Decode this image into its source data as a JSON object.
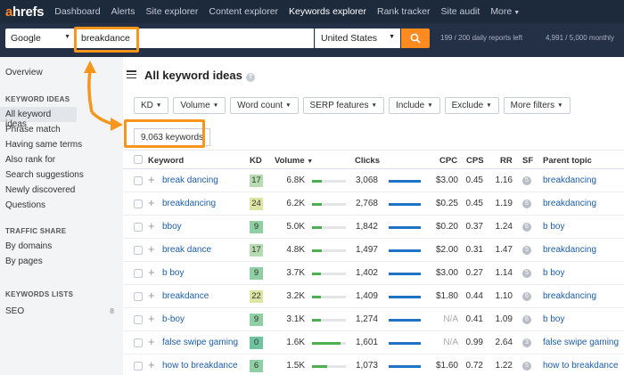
{
  "nav": {
    "logo_a": "a",
    "logo_rest": "hrefs",
    "items": [
      "Dashboard",
      "Alerts",
      "Site explorer",
      "Content explorer",
      "Keywords explorer",
      "Rank tracker",
      "Site audit",
      "More"
    ]
  },
  "search": {
    "engine": "Google",
    "query": "breakdance",
    "country": "United States",
    "limits": "199 / 200 daily reports left",
    "credits": "4,991 / 5,000 monthly"
  },
  "sidebar": {
    "overview": "Overview",
    "keyword_ideas_title": "KEYWORD IDEAS",
    "keyword_ideas": [
      "All keyword ideas",
      "Phrase match",
      "Having same terms",
      "Also rank for",
      "Search suggestions",
      "Newly discovered",
      "Questions"
    ],
    "traffic_share_title": "TRAFFIC SHARE",
    "traffic_share": [
      "By domains",
      "By pages"
    ],
    "keywords_lists_title": "KEYWORDS LISTS",
    "lists": [
      {
        "label": "SEO",
        "count": "8"
      }
    ]
  },
  "main": {
    "title": "All keyword ideas",
    "help": "?",
    "filters": [
      "KD",
      "Volume",
      "Word count",
      "SERP features",
      "Include",
      "Exclude",
      "More filters"
    ],
    "keyword_count": "9,063 keywords"
  },
  "table": {
    "headers": {
      "keyword": "Keyword",
      "kd": "KD",
      "volume": "Volume",
      "clicks": "Clicks",
      "cpc": "CPC",
      "cps": "CPS",
      "rr": "RR",
      "sf": "SF",
      "parent": "Parent topic"
    },
    "rows": [
      {
        "keyword": "break dancing",
        "kd": "17",
        "kd_color": "#b7dcb1",
        "volume": "6.8K",
        "vol_level": 0.3,
        "clicks": "3,068",
        "cpc": "$3.00",
        "cps": "0.45",
        "rr": "1.16",
        "sf": "5",
        "parent": "breakdancing"
      },
      {
        "keyword": "breakdancing",
        "kd": "24",
        "kd_color": "#dde6a0",
        "volume": "6.2K",
        "vol_level": 0.3,
        "clicks": "2,768",
        "cpc": "$0.25",
        "cps": "0.45",
        "rr": "1.19",
        "sf": "6",
        "parent": "breakdancing"
      },
      {
        "keyword": "bboy",
        "kd": "9",
        "kd_color": "#8fcfa3",
        "volume": "5.0K",
        "vol_level": 0.28,
        "clicks": "1,842",
        "cpc": "$0.20",
        "cps": "0.37",
        "rr": "1.24",
        "sf": "6",
        "parent": "b boy"
      },
      {
        "keyword": "break dance",
        "kd": "17",
        "kd_color": "#b7dcb1",
        "volume": "4.8K",
        "vol_level": 0.28,
        "clicks": "1,497",
        "cpc": "$2.00",
        "cps": "0.31",
        "rr": "1.47",
        "sf": "5",
        "parent": "breakdancing"
      },
      {
        "keyword": "b boy",
        "kd": "9",
        "kd_color": "#8fcfa3",
        "volume": "3.7K",
        "vol_level": 0.26,
        "clicks": "1,402",
        "cpc": "$3.00",
        "cps": "0.27",
        "rr": "1.14",
        "sf": "5",
        "parent": "b boy"
      },
      {
        "keyword": "breakdance",
        "kd": "22",
        "kd_color": "#dde6a0",
        "volume": "3.2K",
        "vol_level": 0.26,
        "clicks": "1,409",
        "cpc": "$1.80",
        "cps": "0.44",
        "rr": "1.10",
        "sf": "6",
        "parent": "breakdancing"
      },
      {
        "keyword": "b-boy",
        "kd": "9",
        "kd_color": "#8fcfa3",
        "volume": "3.1K",
        "vol_level": 0.26,
        "clicks": "1,274",
        "cpc": "N/A",
        "cps": "0.41",
        "rr": "1.09",
        "sf": "6",
        "parent": "b boy"
      },
      {
        "keyword": "false swipe gaming",
        "kd": "0",
        "kd_color": "#6fc3a0",
        "volume": "1.6K",
        "vol_level": 0.85,
        "clicks": "1,601",
        "cpc": "N/A",
        "cps": "0.99",
        "rr": "2.64",
        "sf": "3",
        "parent": "false swipe gaming"
      },
      {
        "keyword": "how to breakdance",
        "kd": "6",
        "kd_color": "#8fcfa3",
        "volume": "1.5K",
        "vol_level": 0.45,
        "clicks": "1,073",
        "cpc": "$1.60",
        "cps": "0.72",
        "rr": "1.22",
        "sf": "5",
        "parent": "how to breakdance"
      }
    ]
  },
  "colors": {
    "accent": "#f7961d",
    "nav_bg": "#1d2a3c",
    "link": "#1d5ea8",
    "volume_bar": "#4caf50",
    "clicks_bar": "#1f72c4"
  }
}
